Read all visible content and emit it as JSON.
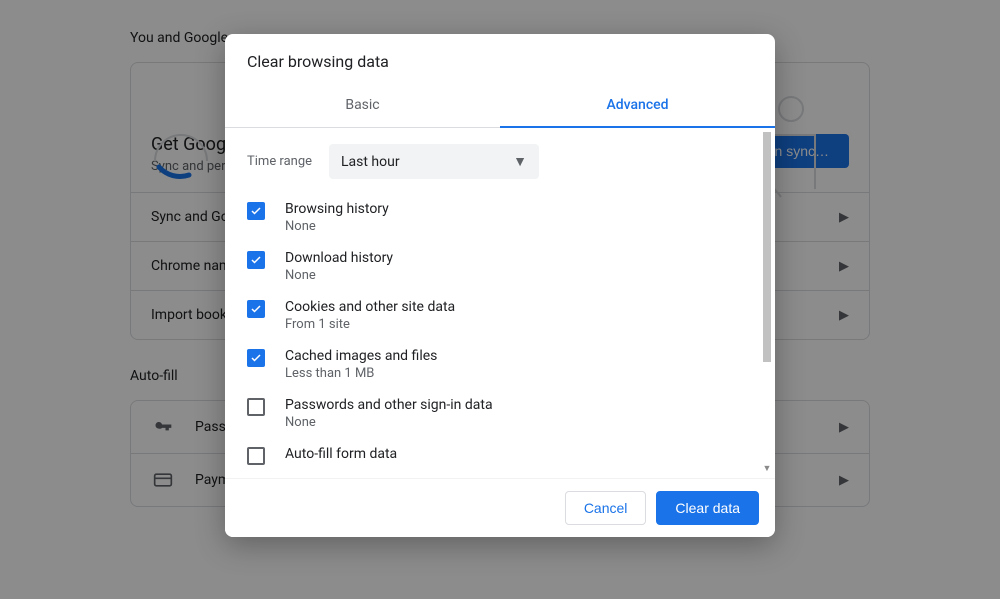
{
  "page": {
    "section1_title": "You and Google",
    "hero_title": "Get Google smarts in Chrome",
    "hero_sub": "Sync and personalize Chrome across your devices",
    "hero_button": "Turn on sync…",
    "rows": [
      {
        "label": "Sync and Google services"
      },
      {
        "label": "Chrome name and picture"
      },
      {
        "label": "Import bookmarks and settings"
      }
    ],
    "section2_title": "Auto-fill",
    "autofill_rows": [
      {
        "label": "Passwords"
      },
      {
        "label": "Payment methods"
      }
    ]
  },
  "dialog": {
    "title": "Clear browsing data",
    "tabs": {
      "basic": "Basic",
      "advanced": "Advanced"
    },
    "time_label": "Time range",
    "time_value": "Last hour",
    "items": [
      {
        "checked": true,
        "label": "Browsing history",
        "sub": "None"
      },
      {
        "checked": true,
        "label": "Download history",
        "sub": "None"
      },
      {
        "checked": true,
        "label": "Cookies and other site data",
        "sub": "From 1 site"
      },
      {
        "checked": true,
        "label": "Cached images and files",
        "sub": "Less than 1 MB"
      },
      {
        "checked": false,
        "label": "Passwords and other sign-in data",
        "sub": "None"
      },
      {
        "checked": false,
        "label": "Auto-fill form data",
        "sub": ""
      }
    ],
    "cancel": "Cancel",
    "confirm": "Clear data"
  }
}
